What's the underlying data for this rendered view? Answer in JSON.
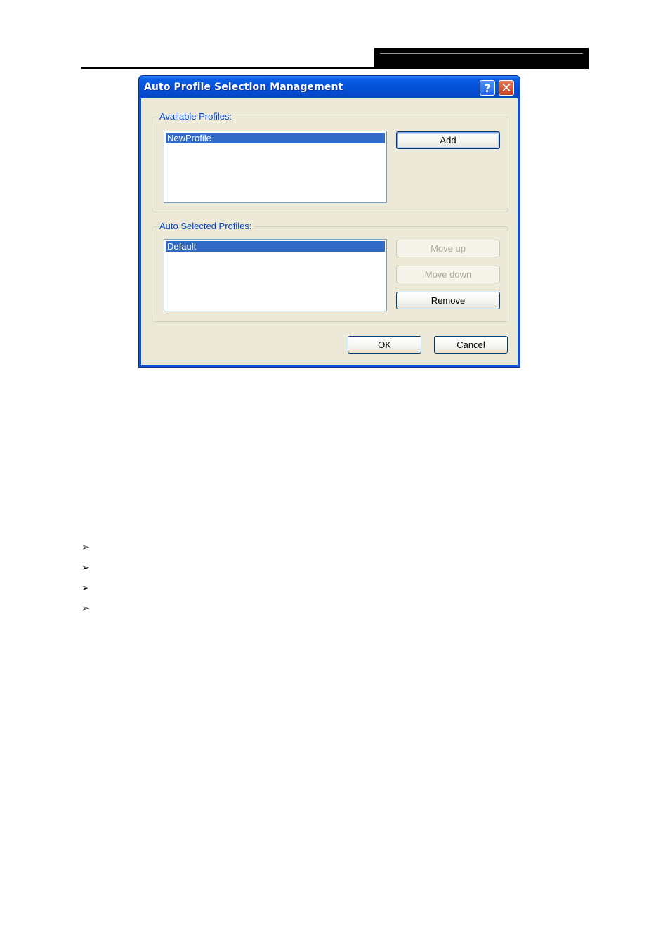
{
  "dialog": {
    "title": "Auto Profile Selection Management",
    "help_icon": "question-mark-icon",
    "close_icon": "close-x-icon",
    "available": {
      "label": "Available Profiles:",
      "items": [
        {
          "label": "NewProfile",
          "selected": true
        }
      ],
      "add_label": "Add"
    },
    "auto_selected": {
      "label": "Auto Selected Profiles:",
      "items": [
        {
          "label": "Default",
          "selected": true
        }
      ],
      "move_up_label": "Move up",
      "move_down_label": "Move down",
      "remove_label": "Remove"
    },
    "ok_label": "OK",
    "cancel_label": "Cancel"
  },
  "colors": {
    "titlebar": "#0450d6",
    "selection": "#316ac5",
    "group_label": "#0046d5",
    "dialog_bg": "#ece9d8"
  },
  "bullet_icon": "arrowhead-bullet-icon"
}
